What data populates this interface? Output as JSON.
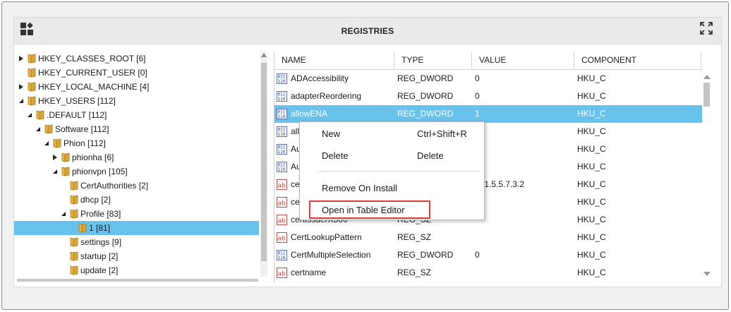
{
  "panel": {
    "title": "REGISTRIES",
    "left_icon": "dashboard-tiles-icon",
    "right_icon": "expand-icon"
  },
  "tree": {
    "items": [
      {
        "label": "HKEY_CLASSES_ROOT [6]",
        "state": "collapsed",
        "depth": 0
      },
      {
        "label": "HKEY_CURRENT_USER [0]",
        "state": "none",
        "depth": 0
      },
      {
        "label": "HKEY_LOCAL_MACHINE [4]",
        "state": "collapsed",
        "depth": 0
      },
      {
        "label": "HKEY_USERS [112]",
        "state": "expanded",
        "depth": 0
      },
      {
        "label": ".DEFAULT [112]",
        "state": "expanded",
        "depth": 1
      },
      {
        "label": "Software [112]",
        "state": "expanded",
        "depth": 2
      },
      {
        "label": "Phion [112]",
        "state": "expanded",
        "depth": 3
      },
      {
        "label": "phionha [6]",
        "state": "collapsed",
        "depth": 4
      },
      {
        "label": "phionvpn [105]",
        "state": "expanded",
        "depth": 4
      },
      {
        "label": "CertAuthorities [2]",
        "state": "none",
        "depth": 5
      },
      {
        "label": "dhcp [2]",
        "state": "none",
        "depth": 5
      },
      {
        "label": "Profile [83]",
        "state": "expanded",
        "depth": 5
      },
      {
        "label": "1 [81]",
        "state": "none",
        "depth": 6,
        "selected": true
      },
      {
        "label": "settings [9]",
        "state": "none",
        "depth": 5
      },
      {
        "label": "startup [2]",
        "state": "none",
        "depth": 5
      },
      {
        "label": "update [2]",
        "state": "none",
        "depth": 5
      }
    ]
  },
  "table": {
    "columns": [
      "NAME",
      "TYPE",
      "VALUE",
      "COMPONENT"
    ],
    "rows": [
      {
        "icon": "dword-icon",
        "name": "ADAccessibility",
        "type": "REG_DWORD",
        "value": "0",
        "component": "HKU_C"
      },
      {
        "icon": "dword-icon",
        "name": "adapterReordering",
        "type": "REG_DWORD",
        "value": "0",
        "component": "HKU_C"
      },
      {
        "icon": "dword-icon",
        "name": "allowENA",
        "type": "REG_DWORD",
        "value": "1",
        "component": "HKU_C",
        "selected": true
      },
      {
        "icon": "dword-icon",
        "name": "all",
        "type": "",
        "value": "",
        "component": "HKU_C"
      },
      {
        "icon": "dword-icon",
        "name": "Au",
        "type": "",
        "value": "",
        "component": "HKU_C"
      },
      {
        "icon": "dword-icon",
        "name": "Au",
        "type": "",
        "value": "",
        "component": "HKU_C"
      },
      {
        "icon": "string-icon",
        "name": "ce",
        "type": "",
        "value": ".6.1.5.5.7.3.2",
        "component": "HKU_C"
      },
      {
        "icon": "string-icon",
        "name": "ce",
        "type": "",
        "value": "",
        "component": "HKU_C"
      },
      {
        "icon": "string-icon",
        "name": "certIssuerX500",
        "type": "REG_SZ",
        "value": "",
        "component": "HKU_C"
      },
      {
        "icon": "string-icon",
        "name": "CertLookupPattern",
        "type": "REG_SZ",
        "value": "",
        "component": "HKU_C"
      },
      {
        "icon": "dword-icon",
        "name": "CertMultipleSelection",
        "type": "REG_DWORD",
        "value": "0",
        "component": "HKU_C"
      },
      {
        "icon": "string-icon",
        "name": "certname",
        "type": "REG_SZ",
        "value": "",
        "component": "HKU_C"
      }
    ]
  },
  "context_menu": {
    "items": [
      {
        "label": "New",
        "shortcut": "Ctrl+Shift+R"
      },
      {
        "label": "Delete",
        "shortcut": "Delete"
      },
      {
        "label": "Remove On Install",
        "shortcut": ""
      },
      {
        "label": "Open in Table Editor",
        "shortcut": "",
        "highlighted": true
      }
    ]
  },
  "colors": {
    "selection": "#67c3ec",
    "highlight_border": "#e0393a",
    "folder": "#d9a636"
  }
}
